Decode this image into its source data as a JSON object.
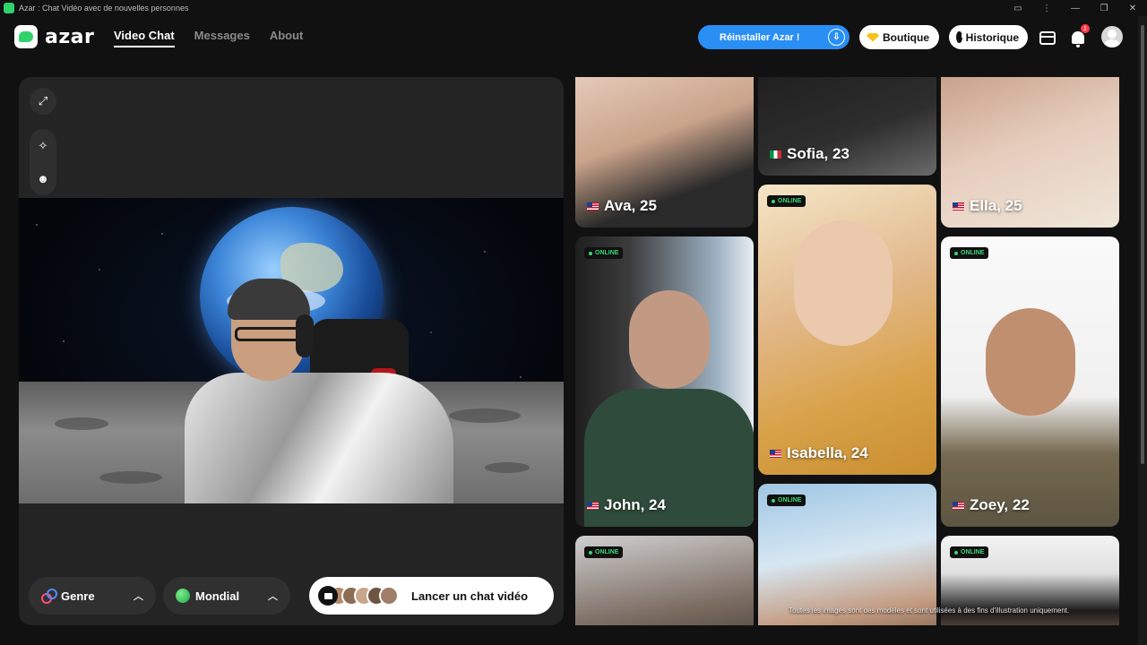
{
  "window": {
    "title": "Azar : Chat Vidéo avec de nouvelles personnes"
  },
  "brand": {
    "logo_text": "azar",
    "accent": "#2fd36a"
  },
  "nav": {
    "tabs": [
      {
        "label": "Video Chat",
        "active": true
      },
      {
        "label": "Messages",
        "active": false
      },
      {
        "label": "About",
        "active": false
      }
    ]
  },
  "header": {
    "reinstall_label": "Réinstaller Azar !",
    "shop_label": "Boutique",
    "history_label": "Historique",
    "notification_count": "1",
    "reinstall_color": "#2a8ff5"
  },
  "stage": {
    "filters": [
      {
        "label": "Genre",
        "icon": "gender-icon"
      },
      {
        "label": "Mondial",
        "icon": "globe-icon"
      }
    ],
    "start_label": "Lancer un chat vidéo"
  },
  "cards": [
    {
      "name": "Ava, 25",
      "country": "us",
      "online": false
    },
    {
      "name": "Sofia, 23",
      "country": "it",
      "online": false
    },
    {
      "name": "Ella, 25",
      "country": "us",
      "online": false
    },
    {
      "name": "John, 24",
      "country": "us",
      "online": true
    },
    {
      "name": "Isabella, 24",
      "country": "us",
      "online": true
    },
    {
      "name": "Zoey, 22",
      "country": "us",
      "online": true
    },
    {
      "name": "",
      "country": "",
      "online": true
    },
    {
      "name": "",
      "country": "",
      "online": true
    },
    {
      "name": "",
      "country": "",
      "online": true
    }
  ],
  "online_label": "ONLINE",
  "disclaimer": "Toutes les images sont des modèles et sont utilisées à des fins d'illustration uniquement."
}
